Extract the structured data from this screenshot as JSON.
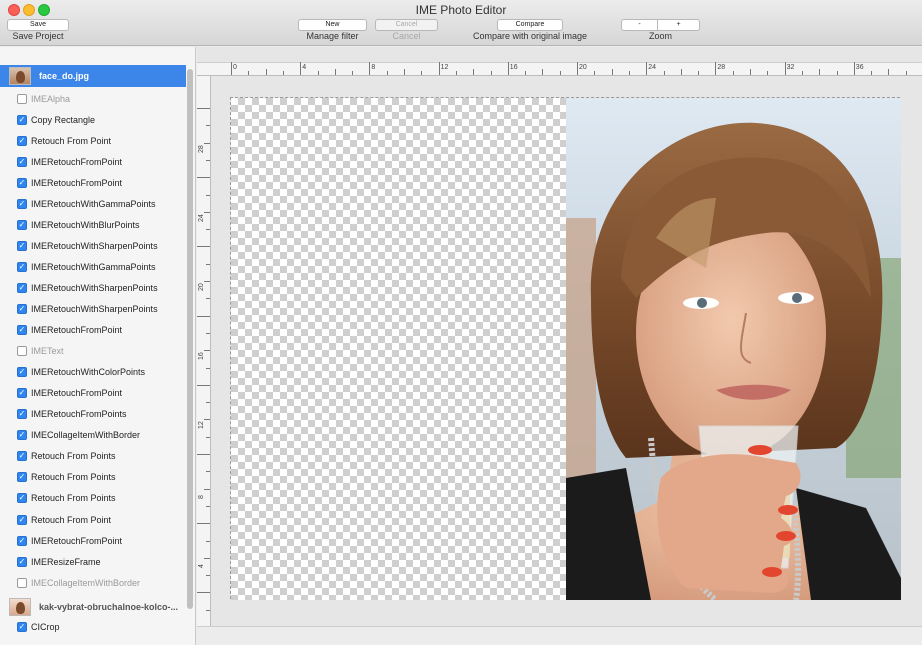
{
  "window": {
    "title": "IME Photo Editor"
  },
  "toolbar": {
    "save_button": "Save",
    "save_caption": "Save Project",
    "new_button": "New",
    "cancel_button": "Cancel",
    "manage_caption": "Manage filter",
    "cancel_caption": "Cancel",
    "compare_button": "Compare",
    "compare_caption": "Compare with original image",
    "zoom_out_button": "-",
    "zoom_in_button": "+",
    "zoom_caption": "Zoom"
  },
  "sidebar": {
    "files": [
      {
        "name": "face_do.jpg",
        "selected": true
      },
      {
        "name": "kak-vybrat-obruchalnoe-kolco-...",
        "selected": false
      }
    ],
    "filters": [
      {
        "label": "IMEAlpha",
        "checked": false
      },
      {
        "label": "Copy Rectangle",
        "checked": true
      },
      {
        "label": "Retouch From Point",
        "checked": true
      },
      {
        "label": "IMERetouchFromPoint",
        "checked": true
      },
      {
        "label": "IMERetouchFromPoint",
        "checked": true
      },
      {
        "label": "IMERetouchWithGammaPoints",
        "checked": true
      },
      {
        "label": "IMERetouchWithBlurPoints",
        "checked": true
      },
      {
        "label": "IMERetouchWithSharpenPoints",
        "checked": true
      },
      {
        "label": "IMERetouchWithGammaPoints",
        "checked": true
      },
      {
        "label": "IMERetouchWithSharpenPoints",
        "checked": true
      },
      {
        "label": "IMERetouchWithSharpenPoints",
        "checked": true
      },
      {
        "label": "IMERetouchFromPoint",
        "checked": true
      },
      {
        "label": "IMEText",
        "checked": false
      },
      {
        "label": "IMERetouchWithColorPoints",
        "checked": true
      },
      {
        "label": "IMERetouchFromPoint",
        "checked": true
      },
      {
        "label": "IMERetouchFromPoints",
        "checked": true
      },
      {
        "label": "IMECollageItemWithBorder",
        "checked": true
      },
      {
        "label": "Retouch From Points",
        "checked": true
      },
      {
        "label": "Retouch From Points",
        "checked": true
      },
      {
        "label": "Retouch From Points",
        "checked": true
      },
      {
        "label": "Retouch From Point",
        "checked": true
      },
      {
        "label": "IMERetouchFromPoint",
        "checked": true
      },
      {
        "label": "IMEResizeFrame",
        "checked": true
      },
      {
        "label": "IMECollageItemWithBorder",
        "checked": false
      }
    ],
    "second_file_filters": [
      {
        "label": "CICrop",
        "checked": true
      }
    ]
  },
  "ruler": {
    "horizontal_labels": [
      "0",
      "4",
      "8",
      "12",
      "16",
      "20",
      "24",
      "28",
      "32",
      "36"
    ],
    "vertical_labels": [
      "28",
      "24",
      "20",
      "16",
      "12",
      "8",
      "4",
      "0"
    ]
  },
  "colors": {
    "selection": "#3b86e8",
    "checkbox_on": "#2f86f0",
    "close": "#fc5f57",
    "minimize": "#fdbc2e",
    "maximize": "#2ac840"
  },
  "icons": {
    "checkbox": "checkmark",
    "file_thumbnail": "image-thumbnail"
  }
}
